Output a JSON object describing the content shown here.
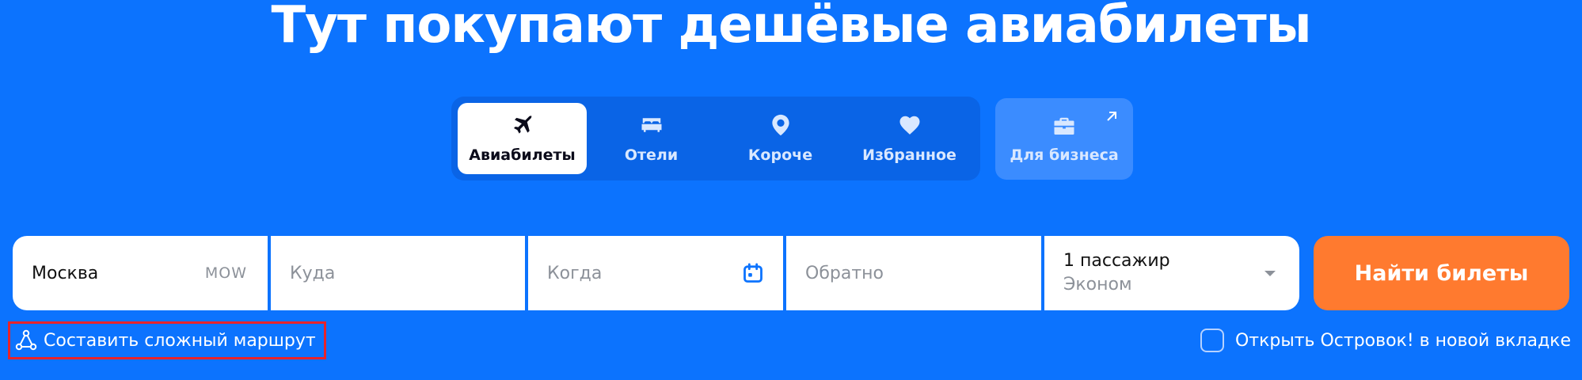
{
  "headline": "Тут покупают дешёвые авиабилеты",
  "tabs": [
    {
      "label": "Авиабилеты",
      "icon": "airplane-icon",
      "active": true
    },
    {
      "label": "Отели",
      "icon": "bed-icon",
      "active": false
    },
    {
      "label": "Короче",
      "icon": "map-pin-icon",
      "active": false
    },
    {
      "label": "Избранное",
      "icon": "heart-icon",
      "active": false
    }
  ],
  "business": {
    "label": "Для бизнеса",
    "icon": "briefcase-icon",
    "external_icon": "arrow-up-right-icon"
  },
  "search": {
    "origin_value": "Москва",
    "origin_code": "MOW",
    "destination_placeholder": "Куда",
    "depart_placeholder": "Когда",
    "return_placeholder": "Обратно",
    "passengers_label": "1 пассажир",
    "cabin_class": "Эконом",
    "submit_label": "Найти билеты"
  },
  "complex_route_label": "Составить сложный маршрут",
  "new_tab_label": "Открыть Островок! в новой вкладке",
  "colors": {
    "background": "#0c73fe",
    "accent_orange": "#ff7a2f",
    "highlight_red": "#e8232a"
  }
}
